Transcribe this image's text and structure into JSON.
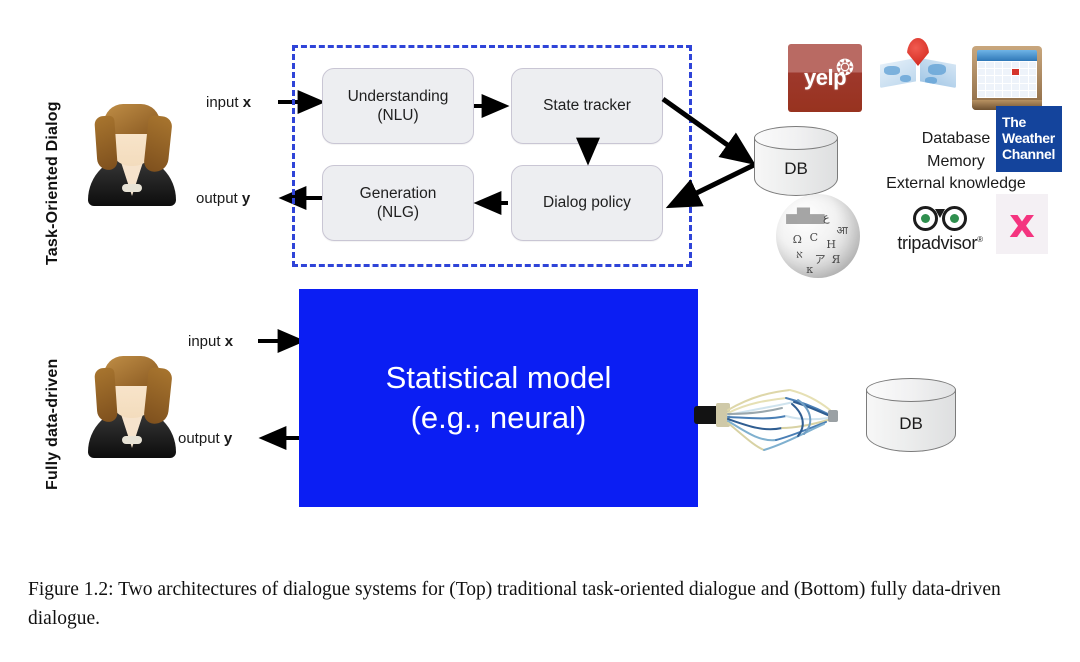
{
  "figure": {
    "rows": [
      {
        "id": "task-oriented",
        "label": "Task-Oriented Dialog"
      },
      {
        "id": "fully-data-driven",
        "label": "Fully data-driven"
      }
    ],
    "top": {
      "input_label_prefix": "input ",
      "input_label_var": "x",
      "output_label_prefix": "output ",
      "output_label_var": "y",
      "modules": [
        {
          "id": "nlu",
          "line1": "Understanding",
          "line2": "(NLU)"
        },
        {
          "id": "state-tracker",
          "line1": "State tracker",
          "line2": ""
        },
        {
          "id": "dialog-policy",
          "line1": "Dialog policy",
          "line2": ""
        },
        {
          "id": "nlg",
          "line1": "Generation",
          "line2": "(NLG)"
        }
      ],
      "db_label": "DB",
      "knowledge_lines": [
        "Database",
        "Memory",
        "External knowledge"
      ],
      "logos": [
        {
          "id": "yelp",
          "name": "yelp-logo",
          "text": "yelp"
        },
        {
          "id": "maps",
          "name": "map-icon",
          "text": ""
        },
        {
          "id": "calendar",
          "name": "calendar-icon",
          "text": ""
        },
        {
          "id": "weather-channel",
          "name": "the-weather-channel-logo",
          "line1": "The",
          "line2": "Weather",
          "line3": "Channel"
        },
        {
          "id": "wikipedia",
          "name": "wikipedia-globe-logo",
          "text": ""
        },
        {
          "id": "tripadvisor",
          "name": "tripadvisor-logo",
          "text": "tripadvisor"
        },
        {
          "id": "foursquare",
          "name": "foursquare-logo",
          "text": "F"
        }
      ]
    },
    "bottom": {
      "input_label_prefix": "input ",
      "input_label_var": "x",
      "output_label_prefix": "output ",
      "output_label_var": "y",
      "model_line1": "Statistical model",
      "model_line2": "(e.g., neural)",
      "db_label": "DB"
    },
    "caption": "Figure 1.2: Two architectures of dialogue systems for (Top) traditional task-oriented dialogue and (Bottom) fully data-driven dialogue."
  },
  "colors": {
    "dashed_border": "#2f44d8",
    "module_fill": "#edeef1",
    "module_border": "#c9c6d4",
    "statistical_model_bg": "#0b1ef3",
    "statistical_model_text": "#ffffff",
    "yelp_red": "#9e382c",
    "weather_blue": "#14449c",
    "foursquare_pink": "#f4347f",
    "arrow": "#000000"
  }
}
